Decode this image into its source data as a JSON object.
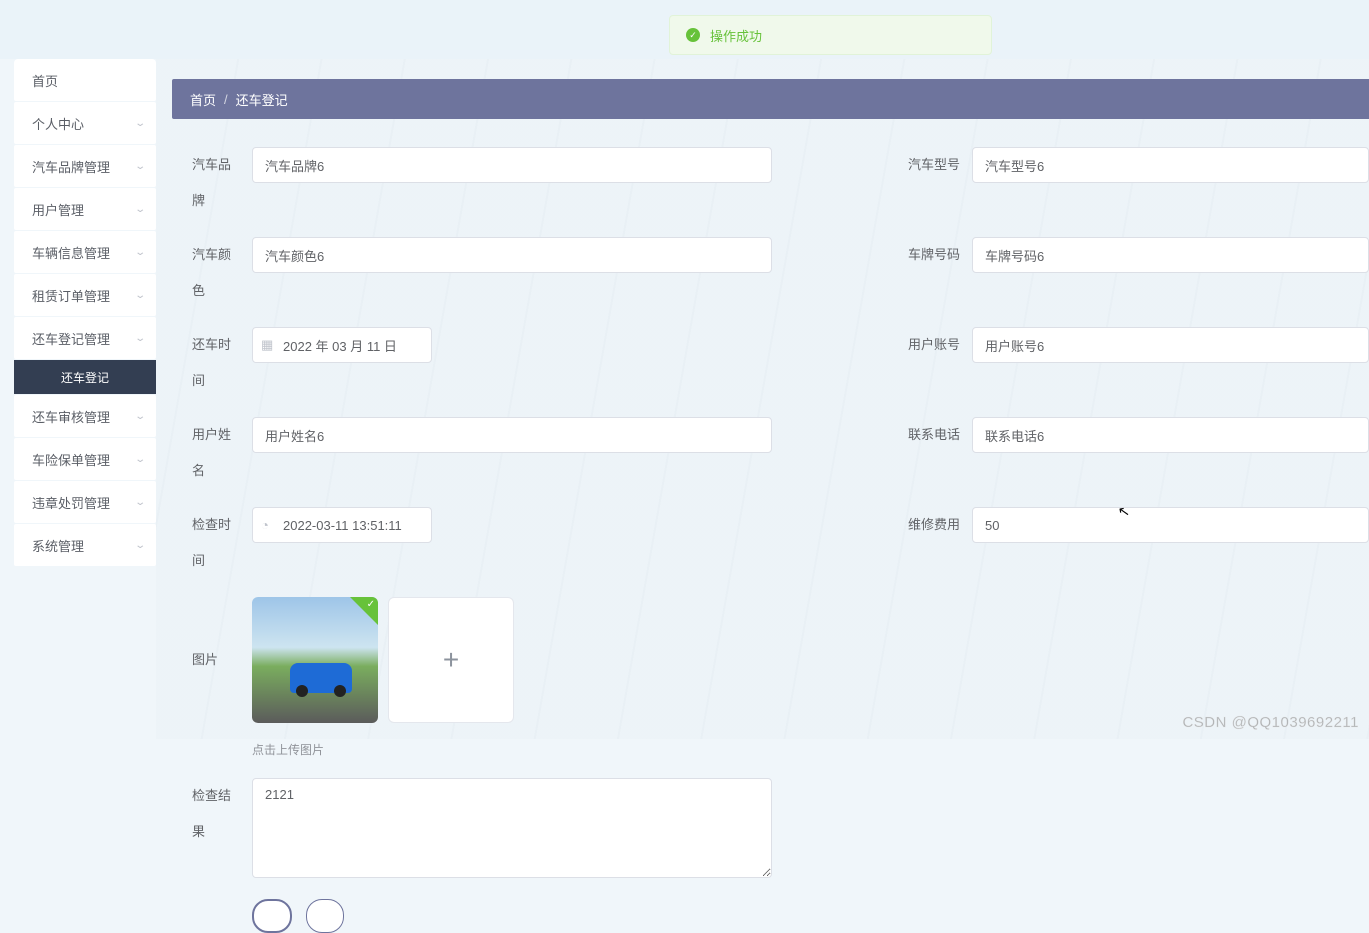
{
  "toast": {
    "text": "操作成功"
  },
  "sidebar": {
    "items": [
      {
        "label": "首页",
        "chev": false
      },
      {
        "label": "个人中心",
        "chev": true
      },
      {
        "label": "汽车品牌管理",
        "chev": true
      },
      {
        "label": "用户管理",
        "chev": true
      },
      {
        "label": "车辆信息管理",
        "chev": true
      },
      {
        "label": "租赁订单管理",
        "chev": true
      },
      {
        "label": "还车登记管理",
        "chev": true
      },
      {
        "label": "还车审核管理",
        "chev": true
      },
      {
        "label": "车险保单管理",
        "chev": true
      },
      {
        "label": "违章处罚管理",
        "chev": true
      },
      {
        "label": "系统管理",
        "chev": true
      }
    ],
    "sub": {
      "label": "还车登记"
    }
  },
  "breadcrumb": {
    "home": "首页",
    "current": "还车登记"
  },
  "form": {
    "brand": {
      "label": "汽车品牌",
      "value": "汽车品牌6"
    },
    "model": {
      "label": "汽车型号",
      "value": "汽车型号6"
    },
    "color": {
      "label": "汽车颜色",
      "value": "汽车颜色6"
    },
    "plate": {
      "label": "车牌号码",
      "value": "车牌号码6"
    },
    "return_time": {
      "label": "还车时间",
      "value": "2022 年 03 月 11 日"
    },
    "account": {
      "label": "用户账号",
      "value": "用户账号6"
    },
    "username": {
      "label": "用户姓名",
      "value": "用户姓名6"
    },
    "phone": {
      "label": "联系电话",
      "value": "联系电话6"
    },
    "check_time": {
      "label": "检查时间",
      "value": "2022-03-11 13:51:11"
    },
    "repair_fee": {
      "label": "维修费用",
      "value": "50"
    },
    "image": {
      "label": "图片",
      "hint": "点击上传图片"
    },
    "result": {
      "label": "检查结果",
      "value": "2121"
    }
  },
  "watermark": "CSDN @QQ1039692211"
}
